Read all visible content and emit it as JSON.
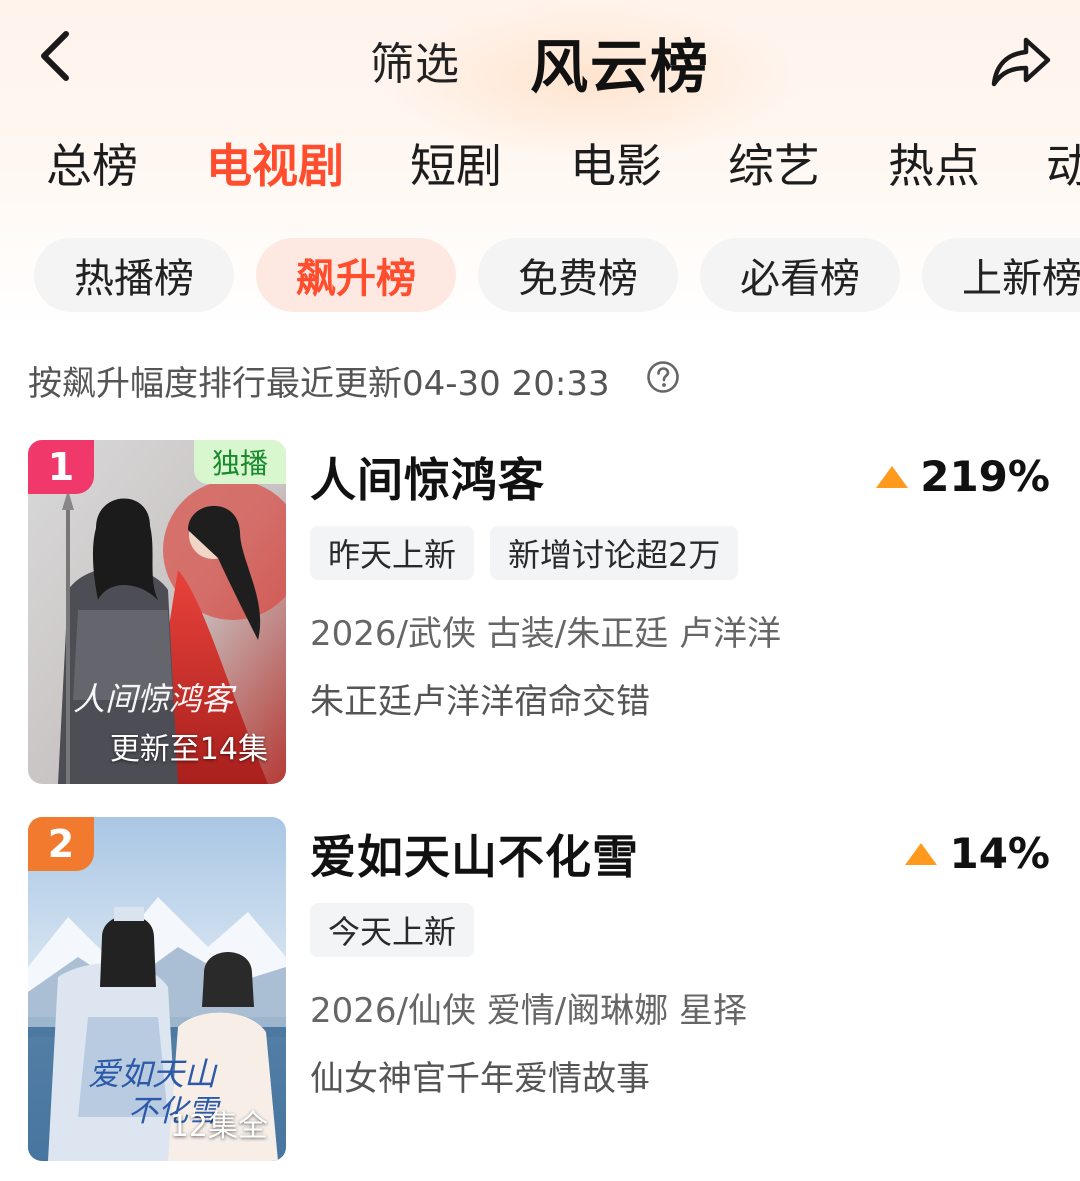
{
  "header": {
    "filter_label": "筛选",
    "title": "风云榜"
  },
  "category_tabs": [
    "总榜",
    "电视剧",
    "短剧",
    "电影",
    "综艺",
    "热点",
    "动"
  ],
  "active_category": "电视剧",
  "sub_tabs": [
    "热播榜",
    "飙升榜",
    "免费榜",
    "必看榜",
    "上新榜"
  ],
  "active_sub_tab": "飙升榜",
  "sort_note": "按飙升幅度排行最近更新04-30 20:33",
  "colors": {
    "accent": "#ff4d2d",
    "rank1": "#f0386b",
    "rank2": "#f27a2e",
    "up_arrow": "#ff9a1f",
    "exclusive_bg": "#d8f7cf"
  },
  "items": [
    {
      "rank": "1",
      "exclusive": "独播",
      "poster_caption": "更新至14集",
      "title": "人间惊鸿客",
      "change": "219%",
      "trend": "up",
      "tags": [
        "昨天上新",
        "新增讨论超2万"
      ],
      "meta": "2026/武侠 古装/朱正廷 卢洋洋",
      "desc": "朱正廷卢洋洋宿命交错"
    },
    {
      "rank": "2",
      "poster_caption": "12集全",
      "title": "爱如天山不化雪",
      "change": "14%",
      "trend": "up",
      "tags": [
        "今天上新"
      ],
      "meta": "2026/仙侠 爱情/阚琳娜 星择",
      "desc": "仙女神官千年爱情故事"
    }
  ]
}
